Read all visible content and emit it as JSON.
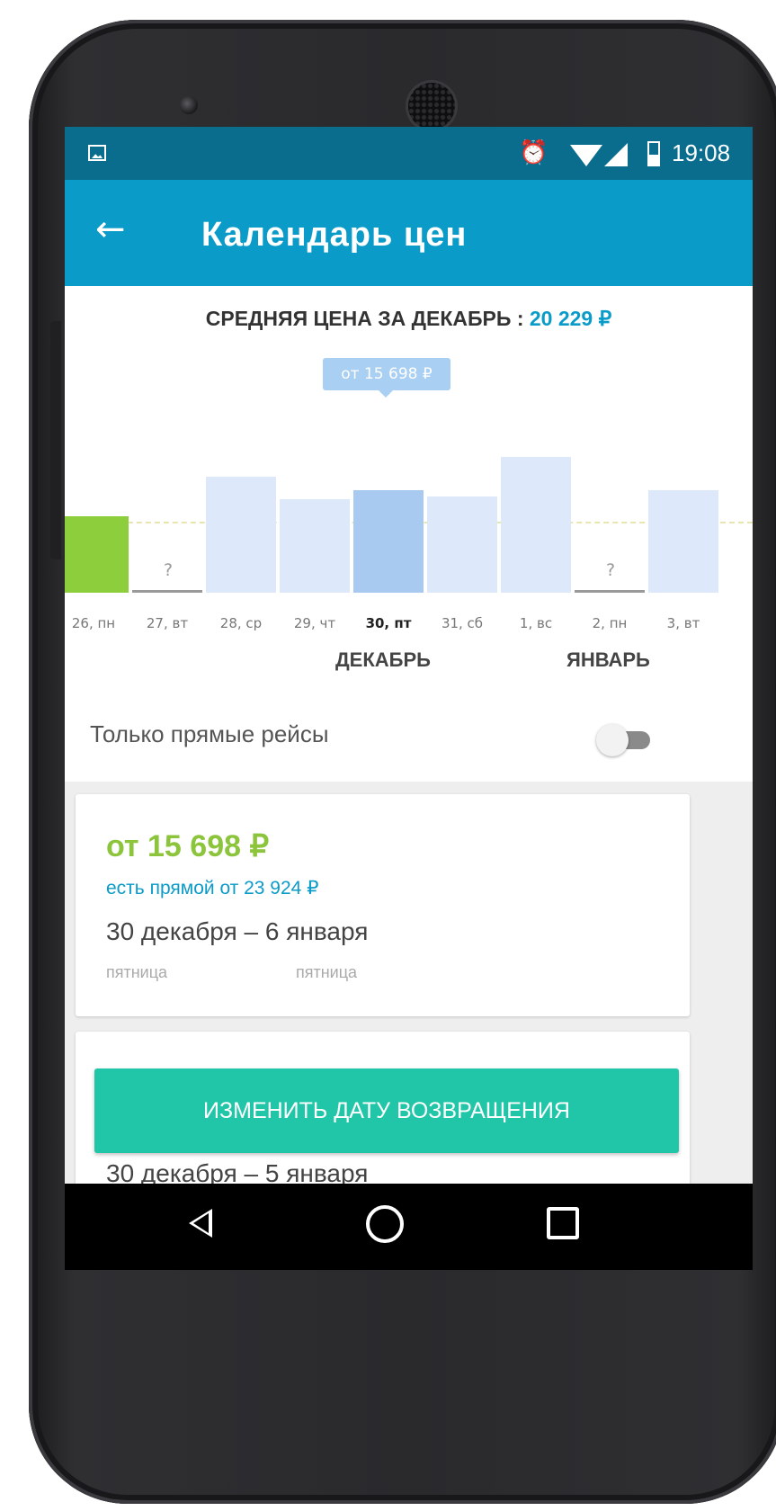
{
  "status_bar": {
    "time": "19:08",
    "alarm_icon": "alarm-icon",
    "wifi_icon": "wifi-icon",
    "signal_icon": "signal-icon",
    "battery_icon": "battery-icon",
    "image_icon": "image-notification-icon"
  },
  "app_bar": {
    "title": "Календарь цен",
    "back_icon": "←"
  },
  "avg": {
    "label": "СРЕДНЯЯ ЦЕНА ЗА ДЕКАБРЬ : ",
    "value": "20 229 ₽"
  },
  "tooltip": "от 15 698 ₽",
  "chart_data": {
    "type": "bar",
    "categories": [
      "26, пн",
      "27, вт",
      "28, ср",
      "29, чт",
      "30, пт",
      "31, сб",
      "1, вс",
      "2, пн",
      "3, вт"
    ],
    "values": [
      20000,
      null,
      23900,
      21700,
      22600,
      21900,
      25900,
      null,
      22600
    ],
    "missing_label": "?",
    "selected_index": 4,
    "highlight_index": 0,
    "average": 20229,
    "months": [
      "ДЕКАБРЬ",
      "ЯНВАРЬ"
    ],
    "colors": {
      "bar": "#dde9fa",
      "selected": "#a8c9f0",
      "cheapest": "#8cce3c"
    }
  },
  "direct_only": {
    "label": "Только прямые рейсы",
    "enabled": false
  },
  "card": {
    "price": "от 15 698 ₽",
    "direct": "есть прямой от 23 924 ₽",
    "dates": "30 декабря  –  6 января",
    "weekday_from": "пятница",
    "weekday_to": "пятница"
  },
  "card2": {
    "dates": "30 декабря  –  5 января"
  },
  "change_button": "ИЗМЕНИТЬ ДАТУ ВОЗВРАЩЕНИЯ",
  "colors": {
    "status_bar": "#0a6d8e",
    "app_bar": "#0b9bc9",
    "accent": "#0b9bc9",
    "price_green": "#8cc43c",
    "button": "#21c6a8"
  }
}
